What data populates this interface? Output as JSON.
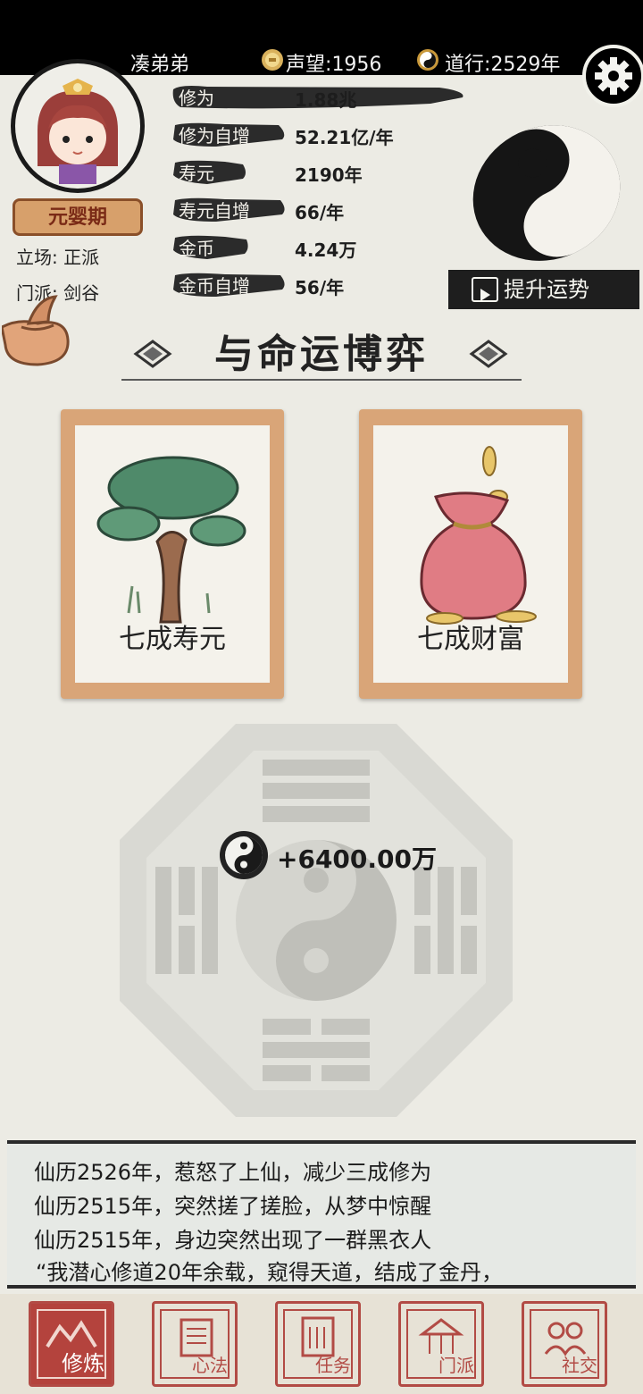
{
  "header": {
    "player_name": "凑弟弟",
    "reputation_label": "声望",
    "reputation_value": "1956",
    "daoxing_label": "道行",
    "daoxing_value": "2529年"
  },
  "profile": {
    "realm": "元婴期",
    "stance": "立场: 正派",
    "sect": "门派: 剑谷"
  },
  "stats": [
    {
      "label": "修为",
      "value": "1.88兆"
    },
    {
      "label": "修为自增",
      "value": "52.21亿/年"
    },
    {
      "label": "寿元",
      "value": "2190年"
    },
    {
      "label": "寿元自增",
      "value": "66/年"
    },
    {
      "label": "金币",
      "value": "4.24万"
    },
    {
      "label": "金币自增",
      "value": "56/年"
    }
  ],
  "luck_button": "提升运势",
  "title": "与命运博弈",
  "cards": [
    {
      "label": "七成寿元",
      "icon": "tree-icon"
    },
    {
      "label": "七成财富",
      "icon": "money-bag-icon"
    }
  ],
  "reward": "+6400.00万",
  "logs": [
    "仙历2526年，惹怒了上仙，减少三成修为",
    "仙历2515年，突然搓了搓脸，从梦中惊醒",
    "仙历2515年，身边突然出现了一群黑衣人",
    "“我潜心修道20年余载，窥得天道，结成了金丹，"
  ],
  "nav": [
    {
      "label": "修炼",
      "active": true
    },
    {
      "label": "心法",
      "active": false
    },
    {
      "label": "任务",
      "active": false
    },
    {
      "label": "门派",
      "active": false
    },
    {
      "label": "社交",
      "active": false
    }
  ],
  "colors": {
    "background": "#ecebe4",
    "accent_red": "#b4433d",
    "card_frame": "#d9a578",
    "ink": "#1e1e1e"
  }
}
